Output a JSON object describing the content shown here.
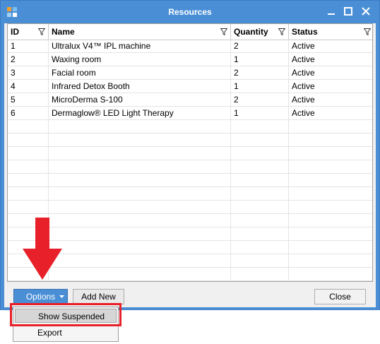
{
  "window": {
    "title": "Resources"
  },
  "table": {
    "columns": [
      "ID",
      "Name",
      "Quantity",
      "Status"
    ],
    "rows": [
      [
        "1",
        "Ultralux V4™ IPL machine",
        "2",
        "Active"
      ],
      [
        "2",
        "Waxing room",
        "1",
        "Active"
      ],
      [
        "3",
        "Facial room",
        "2",
        "Active"
      ],
      [
        "4",
        "Infrared Detox Booth",
        "1",
        "Active"
      ],
      [
        "5",
        "MicroDerma S-100",
        "2",
        "Active"
      ],
      [
        "6",
        "Dermaglow® LED Light Therapy",
        "1",
        "Active"
      ]
    ]
  },
  "buttons": {
    "options": "Options",
    "add_new": "Add New",
    "close": "Close"
  },
  "menu": {
    "items": [
      "Show Suspended",
      "Export"
    ]
  },
  "colors": {
    "accent": "#4a8fd6",
    "annotation": "#e8202a"
  }
}
